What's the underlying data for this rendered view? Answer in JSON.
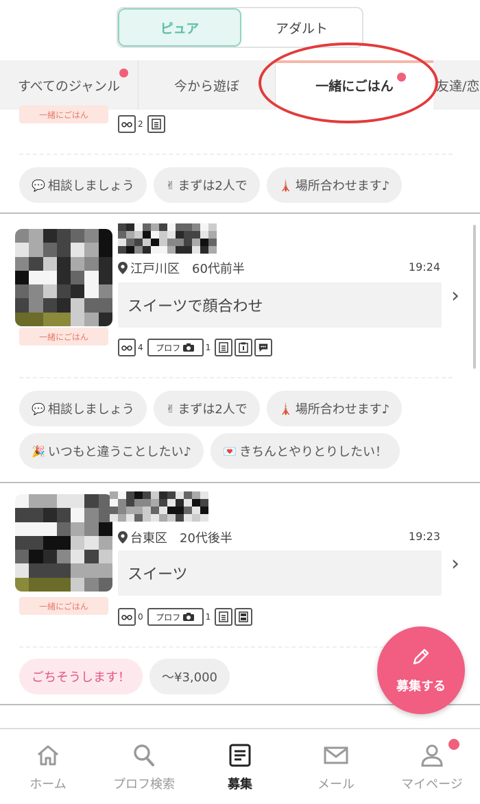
{
  "toggle": {
    "pure": "ピュア",
    "adult": "アダルト"
  },
  "genres": [
    "すべてのジャンル",
    "今から遊ぼ",
    "一緒にごはん",
    "友達/恋"
  ],
  "partial_post": {
    "genre_badge": "一緒にごはん",
    "view_count": "2",
    "chips": [
      {
        "emoji": "💬",
        "label": "相談しましょう"
      },
      {
        "emoji": "✌",
        "label": "まずは2人で"
      },
      {
        "emoji": "🗼",
        "label": "場所合わせます♪"
      }
    ]
  },
  "posts": [
    {
      "genre_badge": "一緒にごはん",
      "area": "江戸川区",
      "age": "60代前半",
      "time": "19:24",
      "message": "スイーツで顔合わせ",
      "view_count": "4",
      "prof_label": "プロフ",
      "photo_count": "1",
      "chips": [
        {
          "emoji": "💬",
          "label": "相談しましょう"
        },
        {
          "emoji": "✌",
          "label": "まずは2人で"
        },
        {
          "emoji": "🗼",
          "label": "場所合わせます♪"
        },
        {
          "emoji": "🎉",
          "label": "いつもと違うことしたい♪"
        },
        {
          "emoji": "💌",
          "label": "きちんとやりとりしたい！"
        }
      ]
    },
    {
      "genre_badge": "一緒にごはん",
      "area": "台東区",
      "age": "20代後半",
      "time": "19:23",
      "message": "スイーツ",
      "view_count": "0",
      "prof_label": "プロフ",
      "photo_count": "1",
      "chips": [
        {
          "emoji": "",
          "label": "ごちそうします！",
          "pink": true
        },
        {
          "emoji": "",
          "label": "〜¥3,000"
        }
      ]
    }
  ],
  "fab": {
    "label": "募集する"
  },
  "nav": [
    {
      "label": "ホーム",
      "icon": "home-icon"
    },
    {
      "label": "プロフ検索",
      "icon": "search-icon"
    },
    {
      "label": "募集",
      "icon": "list-icon"
    },
    {
      "label": "メール",
      "icon": "mail-icon"
    },
    {
      "label": "マイページ",
      "icon": "person-icon"
    }
  ],
  "colors": {
    "accent_teal": "#5cc0a9",
    "accent_pink": "#f25d82",
    "badge_bg": "#fde5e0",
    "highlight": "#e23b3b"
  }
}
